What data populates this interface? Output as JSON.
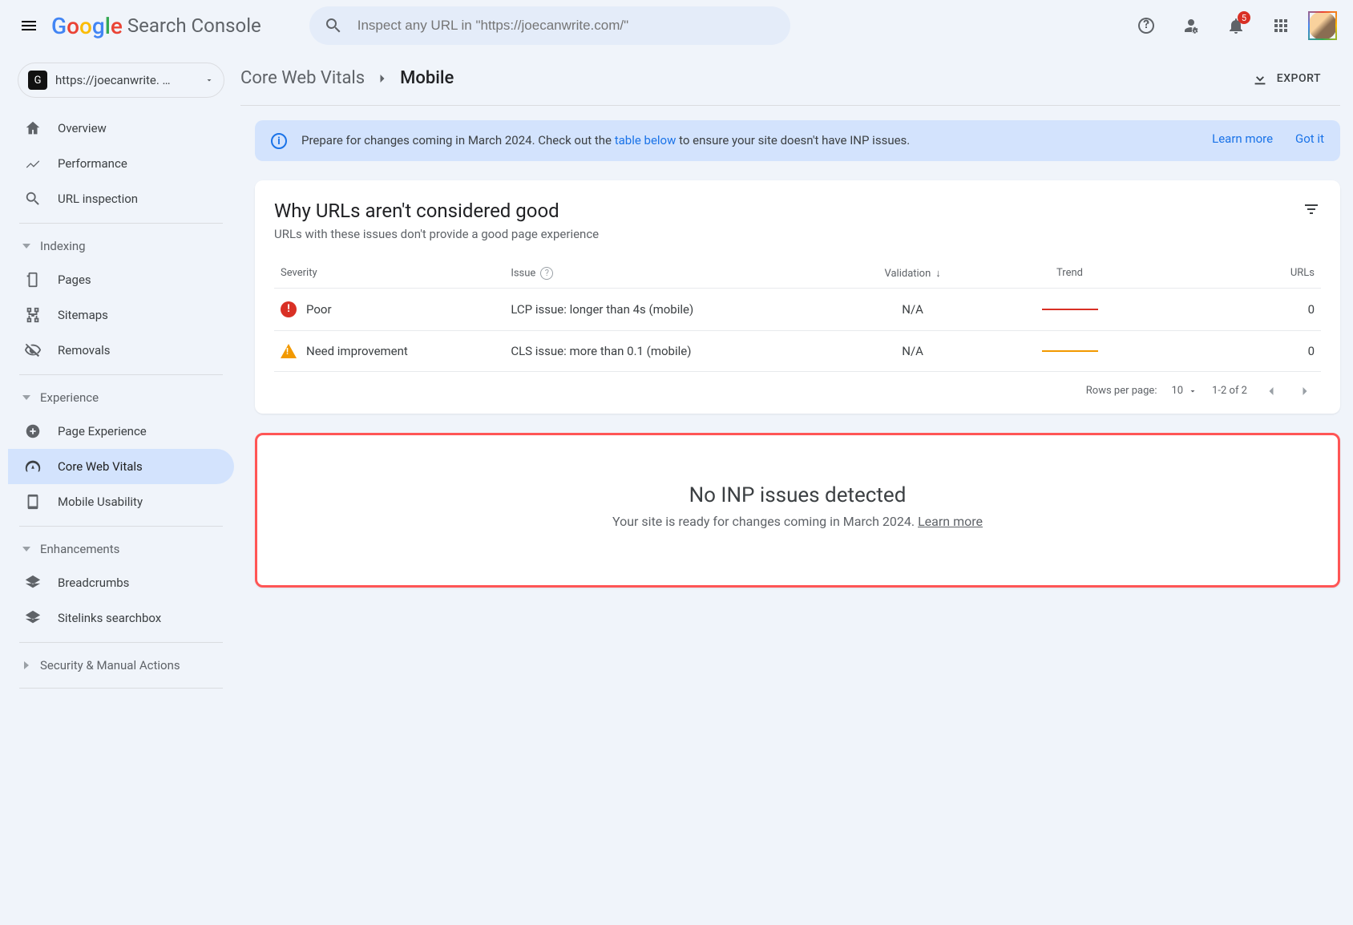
{
  "header": {
    "product": "Search Console",
    "search_placeholder": "Inspect any URL in \"https://joecanwrite.com/\"",
    "notif_count": "5"
  },
  "property": {
    "label": "https://joecanwrite. …"
  },
  "nav": {
    "overview": "Overview",
    "performance": "Performance",
    "url_inspection": "URL inspection",
    "section_indexing": "Indexing",
    "pages": "Pages",
    "sitemaps": "Sitemaps",
    "removals": "Removals",
    "section_experience": "Experience",
    "page_experience": "Page Experience",
    "core_web_vitals": "Core Web Vitals",
    "mobile_usability": "Mobile Usability",
    "section_enhancements": "Enhancements",
    "breadcrumbs": "Breadcrumbs",
    "sitelinks_searchbox": "Sitelinks searchbox",
    "section_security": "Security & Manual Actions"
  },
  "breadcrumb": {
    "parent": "Core Web Vitals",
    "current": "Mobile",
    "export": "EXPORT"
  },
  "banner": {
    "msg_pre": "Prepare for changes coming in March 2024. Check out the ",
    "msg_link": "table below",
    "msg_post": " to ensure your site doesn't have INP issues.",
    "learn_more": "Learn more",
    "got_it": "Got it"
  },
  "issues_card": {
    "title": "Why URLs aren't considered good",
    "subtitle": "URLs with these issues don't provide a good page experience",
    "cols": {
      "severity": "Severity",
      "issue": "Issue",
      "validation": "Validation",
      "trend": "Trend",
      "urls": "URLs"
    },
    "rows": [
      {
        "sev": "Poor",
        "icon": "poor",
        "issue": "LCP issue: longer than 4s (mobile)",
        "validation": "N/A",
        "trend": "red",
        "urls": "0"
      },
      {
        "sev": "Need improvement",
        "icon": "warn",
        "issue": "CLS issue: more than 0.1 (mobile)",
        "validation": "N/A",
        "trend": "yellow",
        "urls": "0"
      }
    ],
    "pager": {
      "rpp_label": "Rows per page:",
      "rpp_value": "10",
      "range": "1-2 of 2"
    }
  },
  "inp_card": {
    "title": "No INP issues detected",
    "subtitle_pre": "Your site is ready for changes coming in March 2024. ",
    "learn_more": "Learn more"
  }
}
